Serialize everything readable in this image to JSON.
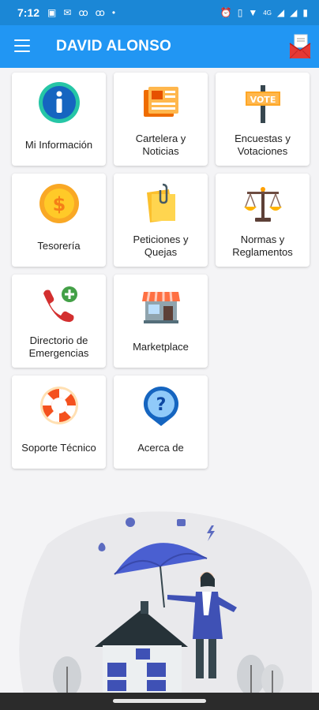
{
  "status_bar": {
    "time": "7:12",
    "left_icons": [
      "message-icon",
      "mail-icon",
      "voicemail-icon",
      "voicemail-icon",
      "dot-icon"
    ],
    "right_icons": [
      "alarm-icon",
      "vibrate-icon",
      "wifi-icon",
      "signal-icon",
      "signal-icon",
      "battery-icon"
    ],
    "network": "4G"
  },
  "app_bar": {
    "title": "DAVID ALONSO",
    "menu_icon": "hamburger-menu-icon",
    "mail_icon": "mailbox-icon"
  },
  "tiles": [
    {
      "label": "Mi Información",
      "icon": "info-icon"
    },
    {
      "label": "Cartelera y Noticias",
      "icon": "newspaper-icon"
    },
    {
      "label": "Encuestas y Votaciones",
      "icon": "vote-sign-icon"
    },
    {
      "label": "Tesorería",
      "icon": "coin-icon"
    },
    {
      "label": "Peticiones y Quejas",
      "icon": "folder-clip-icon"
    },
    {
      "label": "Normas y Reglamentos",
      "icon": "scales-icon"
    },
    {
      "label": "Directorio de Emergencias",
      "icon": "phone-plus-icon"
    },
    {
      "label": "Marketplace",
      "icon": "store-icon"
    },
    {
      "label": "Soporte Técnico",
      "icon": "lifebuoy-icon"
    },
    {
      "label": "Acerca de",
      "icon": "question-pin-icon"
    }
  ],
  "colors": {
    "app_bar": "#2196f3",
    "status_bar": "#1b87d6",
    "background": "#f4f4f6"
  }
}
